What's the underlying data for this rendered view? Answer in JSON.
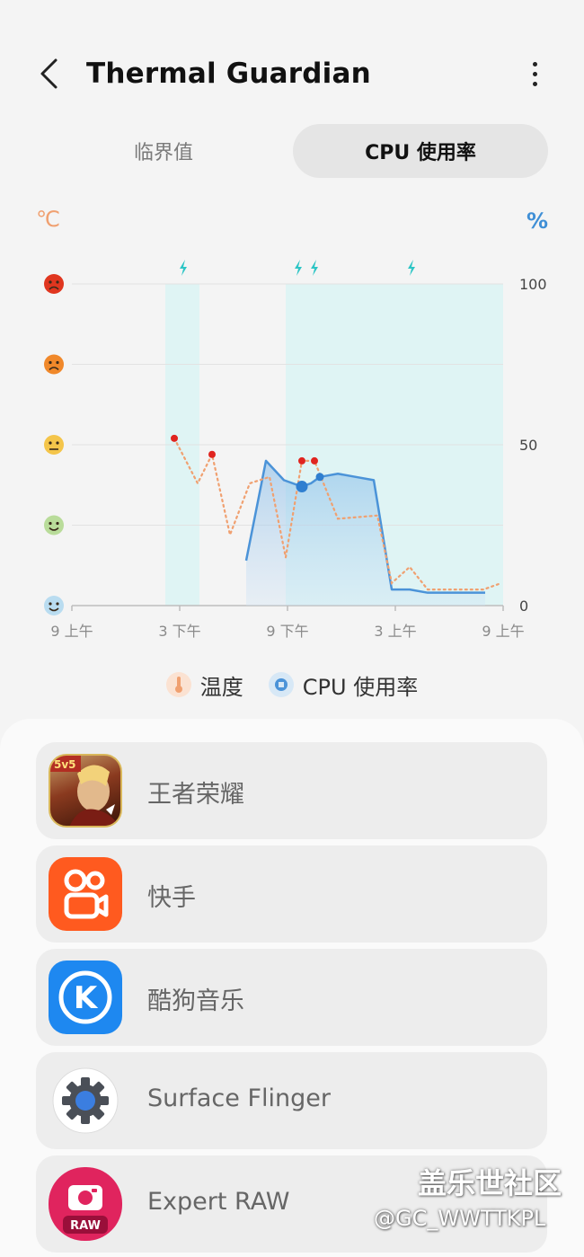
{
  "header": {
    "title": "Thermal Guardian",
    "back_icon": "chevron-left-icon",
    "more_icon": "more-vertical-icon"
  },
  "tabs": [
    {
      "label": "临界值",
      "selected": false
    },
    {
      "label": "CPU 使用率",
      "selected": true
    }
  ],
  "chart_data": {
    "type": "line",
    "left_unit": "℃",
    "right_unit": "%",
    "x_tick_labels": [
      "9 上午",
      "3 下午",
      "9 下午",
      "3 上午",
      "9 上午"
    ],
    "right_ticks": [
      "100",
      "50",
      "0"
    ],
    "left_axis_icons": [
      "hot-face-icon",
      "sad-face-icon",
      "neutral-face-icon",
      "relieved-face-icon",
      "happy-face-icon"
    ],
    "ylim": [
      0,
      100
    ],
    "xlim_hours": [
      0,
      24
    ],
    "charging_bands_hours": [
      [
        5.2,
        7.1
      ],
      [
        11.9,
        24.0
      ]
    ],
    "charging_markers_hours": [
      6.2,
      12.6,
      13.5,
      18.9
    ],
    "series": [
      {
        "name": "温度",
        "style": "dotted",
        "color": "#f0a070",
        "points": [
          [
            5.7,
            52
          ],
          [
            7.0,
            38
          ],
          [
            7.8,
            47
          ],
          [
            8.8,
            22
          ],
          [
            9.9,
            38
          ],
          [
            11.0,
            40
          ],
          [
            11.9,
            15
          ],
          [
            12.8,
            45
          ],
          [
            13.5,
            45
          ],
          [
            14.8,
            27
          ],
          [
            17.0,
            28
          ],
          [
            17.8,
            7
          ],
          [
            18.8,
            12
          ],
          [
            19.8,
            5
          ],
          [
            22.9,
            5
          ],
          [
            23.9,
            7
          ]
        ],
        "highlight_points": [
          [
            5.7,
            52
          ],
          [
            7.8,
            47
          ],
          [
            12.8,
            45
          ],
          [
            13.5,
            45
          ]
        ]
      },
      {
        "name": "CPU 使用率",
        "style": "filled",
        "color": "#4b93d8",
        "points": [
          [
            9.7,
            14
          ],
          [
            10.8,
            45
          ],
          [
            11.8,
            39
          ],
          [
            12.8,
            37
          ],
          [
            13.3,
            38
          ],
          [
            13.8,
            40
          ],
          [
            14.8,
            41
          ],
          [
            15.8,
            40
          ],
          [
            16.8,
            39
          ],
          [
            17.8,
            5
          ],
          [
            18.8,
            5
          ],
          [
            19.8,
            4
          ],
          [
            21.0,
            4
          ],
          [
            23.0,
            4
          ]
        ],
        "highlight_points": [
          [
            12.8,
            37
          ],
          [
            13.8,
            40
          ]
        ]
      }
    ]
  },
  "legend": [
    {
      "label": "温度",
      "icon": "thermometer-icon",
      "color": "#f0a070"
    },
    {
      "label": "CPU 使用率",
      "icon": "cpu-chip-icon",
      "color": "#4b93d8"
    }
  ],
  "apps": [
    {
      "name": "王者荣耀",
      "icon": "honor-of-kings-icon",
      "badge": "5v5"
    },
    {
      "name": "快手",
      "icon": "kuaishou-icon"
    },
    {
      "name": "酷狗音乐",
      "icon": "kugou-music-icon",
      "letter": "K"
    },
    {
      "name": "Surface Flinger",
      "icon": "gear-icon"
    },
    {
      "name": "Expert RAW",
      "icon": "expert-raw-icon",
      "badge": "RAW"
    }
  ],
  "watermark": {
    "brand": "盖乐世社区",
    "user": "@GC_WWTTKPL"
  }
}
